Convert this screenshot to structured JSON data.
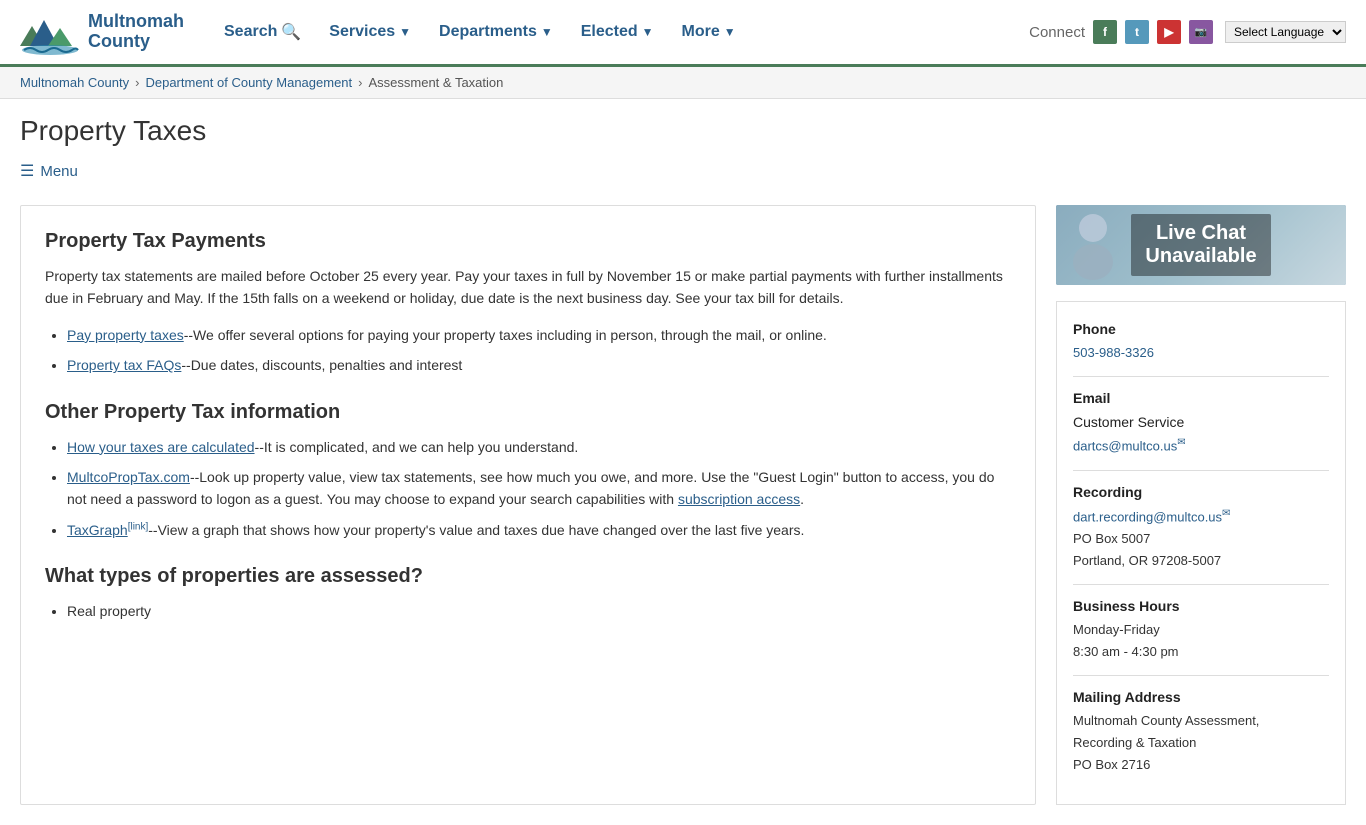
{
  "header": {
    "logo_name": "Multnomah",
    "logo_county": "County",
    "nav": [
      {
        "label": "Search",
        "has_icon": true,
        "has_arrow": false,
        "id": "search"
      },
      {
        "label": "Services",
        "has_icon": false,
        "has_arrow": true,
        "id": "services"
      },
      {
        "label": "Departments",
        "has_icon": false,
        "has_arrow": true,
        "id": "departments"
      },
      {
        "label": "Elected",
        "has_icon": false,
        "has_arrow": true,
        "id": "elected"
      },
      {
        "label": "More",
        "has_icon": false,
        "has_arrow": true,
        "id": "more"
      }
    ],
    "connect_label": "Connect",
    "social": [
      "f",
      "t",
      "▶",
      "📷"
    ],
    "lang_select_label": "Select Language"
  },
  "breadcrumb": {
    "items": [
      {
        "label": "Multnomah County",
        "link": true
      },
      {
        "label": "Department of County Management",
        "link": true
      },
      {
        "label": "Assessment & Taxation",
        "link": false
      }
    ]
  },
  "page": {
    "title": "Property Taxes",
    "menu_label": "Menu"
  },
  "content": {
    "section1_heading": "Property Tax Payments",
    "section1_body": "Property tax statements are mailed before October 25 every year. Pay your taxes in full by November 15 or make partial payments with further installments due in February and May. If the 15th falls on a weekend or holiday, due date is the next business day. See your tax bill for details.",
    "list1": [
      {
        "link_text": "Pay property taxes",
        "rest": "--We offer several options for paying your property taxes including in person, through the mail, or online."
      },
      {
        "link_text": "Property tax FAQs",
        "rest": "--Due dates, discounts, penalties and interest"
      }
    ],
    "section2_heading": "Other Property Tax information",
    "list2": [
      {
        "link_text": "How your taxes are calculated",
        "rest": "--It is complicated, and we can help you understand."
      },
      {
        "link_text": "MultcoPropTax.com",
        "rest": "--Look up property value, view tax statements, see how much you owe, and more. Use the \"Guest Login\" button to access, you do not need a password to logon as a guest. You may choose to expand your search capabilities with ",
        "inline_link": "subscription access",
        "rest2": "."
      },
      {
        "link_text": "TaxGraph",
        "rest": "--View a graph that shows how your property's value and taxes due have changed over the last five years.",
        "has_ext": true
      }
    ],
    "section3_heading": "What types of properties are assessed?",
    "list3": [
      {
        "text": "Real property"
      }
    ]
  },
  "sidebar": {
    "live_chat_line1": "Live Chat",
    "live_chat_line2": "Unavailable",
    "phone_label": "Phone",
    "phone_number": "503-988-3326",
    "email_label": "Email",
    "email_sublabel": "Customer Service",
    "email_address": "dartcs@multco.us",
    "recording_label": "Recording",
    "recording_email": "dart.recording@multco.us",
    "recording_address1": "PO Box 5007",
    "recording_address2": "Portland, OR 97208-5007",
    "hours_label": "Business Hours",
    "hours_days": "Monday-Friday",
    "hours_time": "8:30 am - 4:30 pm",
    "mailing_label": "Mailing Address",
    "mailing_line1": "Multnomah County Assessment,",
    "mailing_line2": "Recording & Taxation",
    "mailing_line3": "PO Box 2716"
  }
}
